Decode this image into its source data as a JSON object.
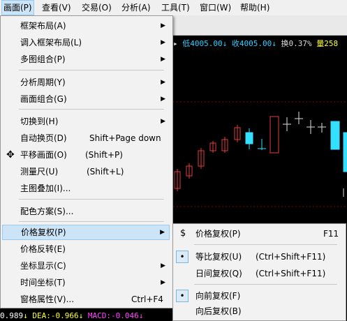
{
  "menubar": {
    "items": [
      "画面(P)",
      "查看(V)",
      "交易(O)",
      "分析(A)",
      "工具(T)",
      "窗口(W)",
      "帮助(H)"
    ]
  },
  "stock_info": {
    "low": "低4005.00",
    "close": "收4005.00",
    "turnover": "换0.37%",
    "volume": "量258"
  },
  "bottom_info": {
    "dif": "0.989",
    "dea": "DEA:-0.966",
    "macd": "MACD:-0.046"
  },
  "main_menu": {
    "items": [
      {
        "label": "框架布局(A)",
        "shortcut": "",
        "submenu": true
      },
      {
        "label": "调入框架布局(L)",
        "shortcut": "",
        "submenu": true
      },
      {
        "label": "多图组合(P)",
        "shortcut": "",
        "submenu": true
      },
      {
        "label": "分析周期(Y)",
        "shortcut": "",
        "submenu": true
      },
      {
        "label": "画面组合(G)",
        "shortcut": "",
        "submenu": true
      },
      {
        "label": "切换到(H)",
        "shortcut": "",
        "submenu": true
      },
      {
        "label": "自动换页(D)",
        "shortcut": "Shift+Page down",
        "submenu": false
      },
      {
        "label": "平移画面(O)",
        "shortcut": "(Shift+P)",
        "submenu": false
      },
      {
        "label": "测量尺(U)",
        "shortcut": "(Shift+L)",
        "submenu": false
      },
      {
        "label": "主图叠加(I)...",
        "shortcut": "",
        "submenu": false
      },
      {
        "label": "配色方案(S)...",
        "shortcut": "",
        "submenu": false
      },
      {
        "label": "价格复权(P)",
        "shortcut": "",
        "submenu": true
      },
      {
        "label": "价格反转(E)",
        "shortcut": "",
        "submenu": false
      },
      {
        "label": "坐标显示(C)",
        "shortcut": "",
        "submenu": true
      },
      {
        "label": "时间坐标(T)",
        "shortcut": "",
        "submenu": true
      },
      {
        "label": "窗格属性(V)...",
        "shortcut": "Ctrl+F4",
        "submenu": false
      }
    ]
  },
  "sub_menu": {
    "items": [
      {
        "label": "价格复权(P)",
        "shortcut": "F11",
        "icon": "$"
      },
      {
        "label": "等比复权(U)",
        "shortcut": "(Ctrl+Shift+F11)",
        "icon": "•"
      },
      {
        "label": "日间复权(Q)",
        "shortcut": "(Ctrl+Shift+F11)",
        "icon": ""
      },
      {
        "label": "向前复权(F)",
        "shortcut": "",
        "icon": "•"
      },
      {
        "label": "向后复权(B)",
        "shortcut": "",
        "icon": ""
      }
    ]
  },
  "icons": {
    "submenu_arrow": "▶",
    "pan_icon": "✥"
  },
  "colors": {
    "menu_highlight": "#cce4f7",
    "up_candle": "#e03c3c",
    "down_candle": "#33e0ff",
    "neutral_candle": "#e0e0e0"
  }
}
